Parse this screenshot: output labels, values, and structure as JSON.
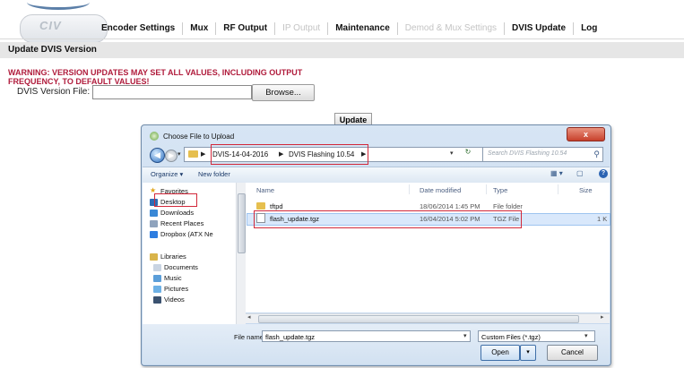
{
  "logo": {
    "text": "CIV"
  },
  "nav": {
    "items": [
      {
        "label": "Encoder Settings",
        "enabled": true
      },
      {
        "label": "Mux",
        "enabled": true
      },
      {
        "label": "RF Output",
        "enabled": true
      },
      {
        "label": "IP Output",
        "enabled": false
      },
      {
        "label": "Maintenance",
        "enabled": true
      },
      {
        "label": "Demod & Mux Settings",
        "enabled": false
      },
      {
        "label": "DVIS Update",
        "enabled": true
      },
      {
        "label": "Log",
        "enabled": true
      }
    ]
  },
  "page": {
    "section_title": "Update DVIS Version",
    "warning_line1": "WARNING: VERSION UPDATES MAY SET ALL VALUES, INCLUDING OUTPUT",
    "warning_line2": "FREQUENCY, TO DEFAULT VALUES!",
    "file_label": "DVIS Version File:",
    "file_value": "",
    "browse_label": "Browse...",
    "update_label": "Update",
    "warning_color": "#b01c3c"
  },
  "dialog": {
    "title": "Choose File to Upload",
    "close_label": "x",
    "breadcrumbs": [
      "DVIS-14-04-2016",
      "DVIS Flashing 10.54"
    ],
    "search_placeholder": "Search DVIS Flashing 10.54",
    "toolbar": {
      "organize": "Organize ▾",
      "new_folder": "New folder"
    },
    "sidebar": {
      "favorites_header": "Favorites",
      "favorites": [
        "Desktop",
        "Downloads",
        "Recent Places",
        "Dropbox (ATX Ne"
      ],
      "libraries_header": "Libraries",
      "libraries": [
        "Documents",
        "Music",
        "Pictures",
        "Videos"
      ]
    },
    "columns": [
      "Name",
      "Date modified",
      "Type",
      "Size"
    ],
    "files": [
      {
        "name": "tftpd",
        "date": "18/06/2014 1:45 PM",
        "type": "File folder",
        "size": ""
      },
      {
        "name": "flash_update.tgz",
        "date": "16/04/2014 5:02 PM",
        "type": "TGZ File",
        "size": "1 K"
      }
    ],
    "file_name_label": "File name:",
    "file_name_value": "flash_update.tgz",
    "filter_value": "Custom Files (*.tgz)",
    "open_label": "Open",
    "cancel_label": "Cancel",
    "highlight_color": "#d2283a"
  }
}
